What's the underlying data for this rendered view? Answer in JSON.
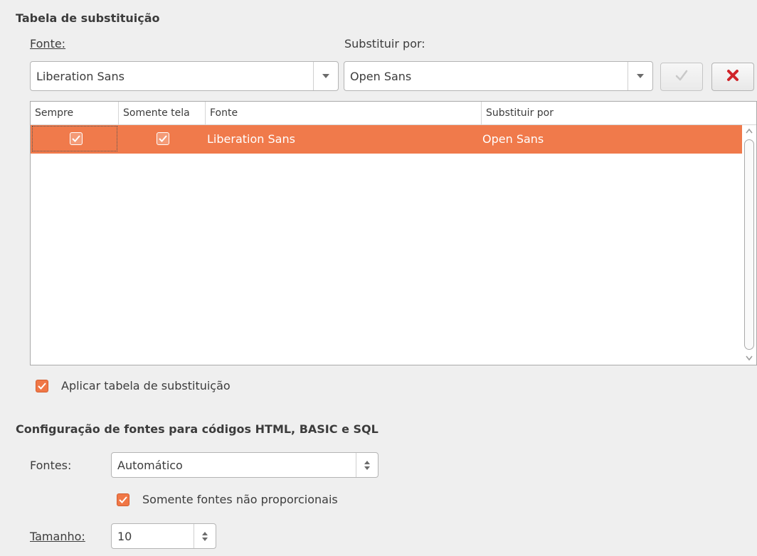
{
  "replacement": {
    "title": "Tabela de substituição",
    "font_label": "Fonte:",
    "replace_label": "Substituir por:",
    "font_value": "Liberation Sans",
    "replace_value": "Open Sans",
    "apply_icon": "checkmark-icon",
    "delete_icon": "red-x-icon"
  },
  "table": {
    "headers": [
      "Sempre",
      "Somente tela",
      "Fonte",
      "Substituir por"
    ],
    "rows": [
      {
        "always": true,
        "screen_only": true,
        "font": "Liberation Sans",
        "replace_with": "Open Sans"
      }
    ]
  },
  "apply_table": {
    "label": "Aplicar tabela de substituição",
    "checked": true
  },
  "source_fonts": {
    "title": "Configuração de fontes para códigos HTML, BASIC e SQL",
    "fonts_label": "Fontes:",
    "fonts_value": "Automático",
    "nonprop_label": "Somente fontes não proporcionais",
    "nonprop_checked": true,
    "size_label": "Tamanho:",
    "size_value": "10"
  },
  "colors": {
    "accent": "#f07a4b",
    "delete": "#d0242a"
  }
}
